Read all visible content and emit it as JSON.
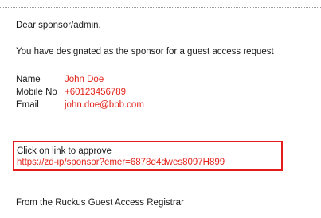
{
  "email": {
    "greeting": "Dear sponsor/admin,",
    "intro": "You have designated as the sponsor for a guest access request",
    "details": [
      {
        "label": "Name",
        "value": "John Doe"
      },
      {
        "label": "Mobile No",
        "value": "+60123456789"
      },
      {
        "label": "Email",
        "value": "john.doe@bbb.com"
      }
    ],
    "approve": {
      "prompt": "Click on link to approve",
      "link": "https://zd-ip/sponsor?emer=6878d4dwes8097H899"
    },
    "signature": "From the Ruckus Guest Access Registrar"
  },
  "colors": {
    "value_text": "#e3241b",
    "highlight_border": "#e31b1b"
  }
}
